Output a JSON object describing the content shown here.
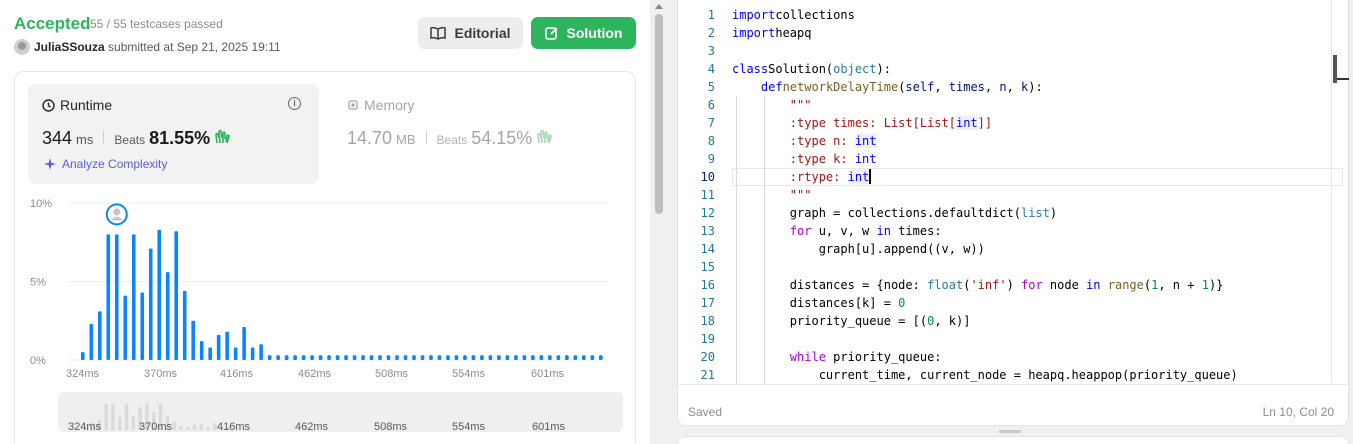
{
  "result": {
    "status": "Accepted",
    "testcases": "55 / 55 testcases passed",
    "user": "JuliaSSouza",
    "submitted": "submitted at Sep 21, 2025 19:11"
  },
  "buttons": {
    "editorial": "Editorial",
    "solution": "Solution"
  },
  "runtime": {
    "label": "Runtime",
    "value": "344",
    "unit": "ms",
    "beats_label": "Beats",
    "beats_pct": "81.55%",
    "analyze": "Analyze Complexity"
  },
  "memory": {
    "label": "Memory",
    "value": "14.70",
    "unit": "MB",
    "beats_label": "Beats",
    "beats_pct": "54.15%"
  },
  "colors": {
    "accent_green": "#2db55d",
    "bar_blue": "#0a84ff",
    "analyze_purple": "#5a5fd6"
  },
  "chart_data": {
    "type": "bar",
    "ytick_labels": [
      "10%",
      "5%",
      "0%"
    ],
    "yticks": [
      10,
      5,
      0
    ],
    "ylim": [
      0,
      10
    ],
    "xtick_labels": [
      "324ms",
      "370ms",
      "416ms",
      "462ms",
      "508ms",
      "554ms",
      "601ms"
    ],
    "values": [
      0.5,
      2.3,
      3.1,
      8.0,
      8.0,
      4.1,
      8.0,
      4.3,
      7.1,
      8.3,
      5.6,
      8.2,
      4.4,
      2.5,
      1.2,
      0.8,
      1.6,
      1.8,
      0.8,
      2.1,
      0.8,
      1.0,
      0.3,
      0.3,
      0.3,
      0.3,
      0.3,
      0.3,
      0.3,
      0.3,
      0.3,
      0.3,
      0.3,
      0.3,
      0.3,
      0.3,
      0.3,
      0.3,
      0.3,
      0.3,
      0.3,
      0.3,
      0.3,
      0.3,
      0.3,
      0.3,
      0.3,
      0.3,
      0.3,
      0.3,
      0.3,
      0.3,
      0.3,
      0.3,
      0.3,
      0.3,
      0.3,
      0.3,
      0.3,
      0.3,
      0.3,
      0.3
    ],
    "highlight_index": 4,
    "mini_values": [
      0.5,
      2.3,
      3.1,
      8.0,
      8.0,
      4.1,
      8.0,
      4.3,
      7.1,
      8.3,
      5.6,
      8.2,
      4.4,
      2.5,
      1.2,
      0.8,
      1.6,
      1.8,
      0.8,
      2.1,
      0.8,
      1.0
    ],
    "mini_xtick_labels": [
      "324ms",
      "370ms",
      "416ms",
      "462ms",
      "508ms",
      "554ms",
      "601ms"
    ]
  },
  "code": {
    "lines": [
      [
        [
          "kw",
          "import"
        ],
        [
          "",
          "collections"
        ]
      ],
      [
        [
          "kw",
          "import"
        ],
        [
          "",
          "heapq"
        ]
      ],
      [],
      [
        [
          "kw",
          "class"
        ],
        [
          "",
          "Solution("
        ],
        [
          "cls",
          "object"
        ],
        [
          "",
          "):"
        ]
      ],
      [
        [
          "",
          "    "
        ],
        [
          "kw",
          "def"
        ],
        [
          "",
          ""
        ],
        [
          "fn",
          "networkDelayTime"
        ],
        [
          "",
          "("
        ],
        [
          "prm",
          "self"
        ],
        [
          "",
          ", "
        ],
        [
          "prm",
          "times"
        ],
        [
          "",
          ", "
        ],
        [
          "prm",
          "n"
        ],
        [
          "",
          ", "
        ],
        [
          "prm",
          "k"
        ],
        [
          "",
          "):"
        ]
      ],
      [
        [
          "",
          "        "
        ],
        [
          "str",
          "\"\"\""
        ]
      ],
      [
        [
          "",
          "        "
        ],
        [
          "str",
          ":type times: List[List["
        ],
        [
          "tyh",
          "int"
        ],
        [
          "str",
          "]]"
        ]
      ],
      [
        [
          "",
          "        "
        ],
        [
          "str",
          ":type n: "
        ],
        [
          "tyh",
          "int"
        ]
      ],
      [
        [
          "",
          "        "
        ],
        [
          "str",
          ":type k: "
        ],
        [
          "ty",
          "int"
        ]
      ],
      [
        [
          "",
          "        "
        ],
        [
          "str",
          ":rtype: "
        ],
        [
          "tyh",
          "int"
        ],
        [
          "cursor",
          ""
        ]
      ],
      [
        [
          "",
          "        "
        ],
        [
          "str",
          "\"\"\""
        ]
      ],
      [
        [
          "",
          "        graph = collections.defaultdict("
        ],
        [
          "cls",
          "list"
        ],
        [
          "",
          ")"
        ]
      ],
      [
        [
          "",
          "        "
        ],
        [
          "kw2",
          "for"
        ],
        [
          "",
          " u, v, w "
        ],
        [
          "kw",
          "in"
        ],
        [
          "",
          " times:"
        ]
      ],
      [
        [
          "",
          "            graph[u].append((v, w))"
        ]
      ],
      [],
      [
        [
          "",
          "        distances = {node: "
        ],
        [
          "cls",
          "float"
        ],
        [
          "",
          "("
        ],
        [
          "str",
          "'inf'"
        ],
        [
          "",
          ") "
        ],
        [
          "kw2",
          "for"
        ],
        [
          "",
          " node "
        ],
        [
          "kw",
          "in"
        ],
        [
          "",
          " "
        ],
        [
          "fn",
          "range"
        ],
        [
          "",
          "("
        ],
        [
          "num",
          "1"
        ],
        [
          "",
          ", n + "
        ],
        [
          "num",
          "1"
        ],
        [
          "",
          ")}"
        ]
      ],
      [
        [
          "",
          "        distances[k] = "
        ],
        [
          "num",
          "0"
        ]
      ],
      [
        [
          "",
          "        priority_queue = [("
        ],
        [
          "num",
          "0"
        ],
        [
          "",
          ", k)]"
        ]
      ],
      [],
      [
        [
          "",
          "        "
        ],
        [
          "kw2",
          "while"
        ],
        [
          "",
          " priority_queue:"
        ]
      ],
      [
        [
          "",
          "            current_time, current_node = heapq.heappop(priority_queue)"
        ]
      ]
    ],
    "current_line": 10
  },
  "editor_footer": {
    "saved": "Saved",
    "position": "Ln 10, Col 20"
  }
}
